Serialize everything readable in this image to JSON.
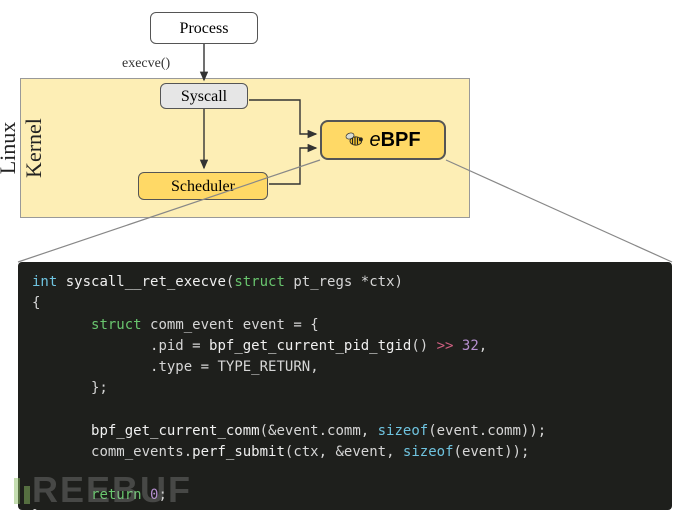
{
  "diagram": {
    "kernel_label": "Linux\nKernel",
    "nodes": {
      "process": "Process",
      "syscall": "Syscall",
      "scheduler": "Scheduler",
      "ebpf": "eBPF"
    },
    "edges": {
      "execve": "execve()"
    }
  },
  "code": {
    "sig_type": "int",
    "sig_name": "syscall__ret_execve",
    "sig_param_kw": "struct",
    "sig_param_type": "pt_regs",
    "sig_param_name": "*ctx",
    "decl_kw": "struct",
    "decl_type": "comm_event",
    "decl_name": "event",
    "field_pid": ".pid",
    "pid_call": "bpf_get_current_pid_tgid",
    "shift_op": ">>",
    "shift_val": "32",
    "field_type": ".type",
    "type_val": "TYPE_RETURN",
    "call1": "bpf_get_current_comm",
    "call1_arg1": "&event.comm",
    "sizeof_kw": "sizeof",
    "call1_arg2": "event.comm",
    "call2_obj": "comm_events",
    "call2_fn": "perf_submit",
    "call2_arg1": "ctx",
    "call2_arg2": "&event",
    "call2_arg3": "event",
    "return_kw": "return",
    "return_val": "0"
  },
  "watermark": "REEBUF"
}
